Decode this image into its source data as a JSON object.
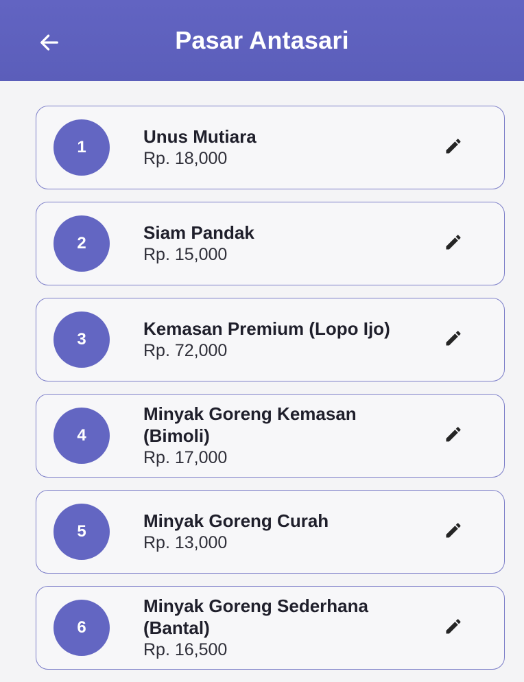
{
  "header": {
    "title": "Pasar Antasari",
    "back_icon": "arrow-left-icon"
  },
  "colors": {
    "appbar": "#5f62c0",
    "badge": "#6366c2",
    "card_border": "#7b7dc8"
  },
  "items": [
    {
      "number": "1",
      "name": "Unus Mutiara",
      "price": "Rp. 18,000",
      "edit_icon": "pencil-icon"
    },
    {
      "number": "2",
      "name": "Siam Pandak",
      "price": "Rp. 15,000",
      "edit_icon": "pencil-icon"
    },
    {
      "number": "3",
      "name": "Kemasan Premium (Lopo Ijo)",
      "price": "Rp. 72,000",
      "edit_icon": "pencil-icon"
    },
    {
      "number": "4",
      "name": "Minyak Goreng Kemasan (Bimoli)",
      "price": "Rp. 17,000",
      "edit_icon": "pencil-icon"
    },
    {
      "number": "5",
      "name": "Minyak Goreng Curah",
      "price": "Rp. 13,000",
      "edit_icon": "pencil-icon"
    },
    {
      "number": "6",
      "name": "Minyak Goreng Sederhana (Bantal)",
      "price": "Rp. 16,500",
      "edit_icon": "pencil-icon"
    }
  ]
}
